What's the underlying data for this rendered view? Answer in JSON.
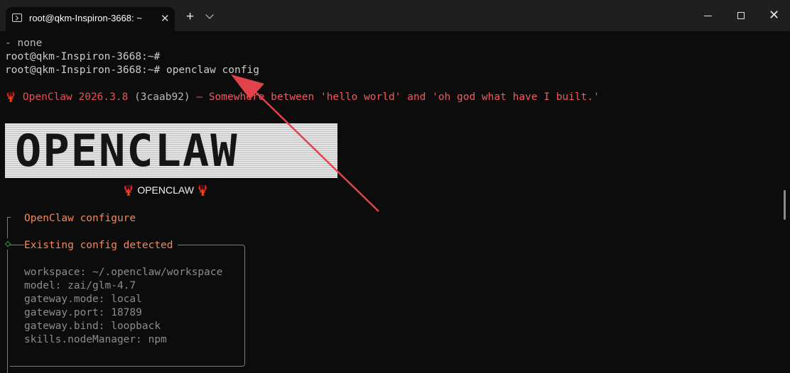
{
  "window": {
    "tab_title": "root@qkm-Inspiron-3668: ~",
    "tab_close": "✕",
    "new_tab": "+",
    "close_glyph": "✕"
  },
  "terminal": {
    "prev_output": "- none",
    "prompt_empty": "root@qkm-Inspiron-3668:~#",
    "prompt_cmd": "root@qkm-Inspiron-3668:~# openclaw config",
    "version_lobster": "🦞",
    "version_name": "OpenClaw 2026.3.8",
    "version_hash": "(3caab92)",
    "version_tagline": " — Somewhere between 'hello world' and 'oh god what have I built.'",
    "banner_text": "OPENCLAW",
    "banner_caption_left": "🦞",
    "banner_caption": " OPENCLAW ",
    "banner_caption_right": "🦞"
  },
  "configure": {
    "title": "OpenClaw configure",
    "detected_heading": "Existing config detected",
    "entries": [
      "workspace: ~/.openclaw/workspace",
      "model: zai/glm-4.7",
      "gateway.mode: local",
      "gateway.port: 18789",
      "gateway.bind: loopback",
      "skills.nodeManager: npm"
    ]
  },
  "colors": {
    "background": "#0c0c0c",
    "accent_red": "#e84f56",
    "heading_orange": "#f08a5a",
    "annotation_arrow": "#e0444a",
    "diamond_green": "#2ea043"
  },
  "icons": {
    "tab": "terminal-icon",
    "dropdown": "chevron-down-icon",
    "minimize": "minimize-icon",
    "maximize": "maximize-icon",
    "close": "close-icon",
    "annotation": "arrow-annotation"
  }
}
